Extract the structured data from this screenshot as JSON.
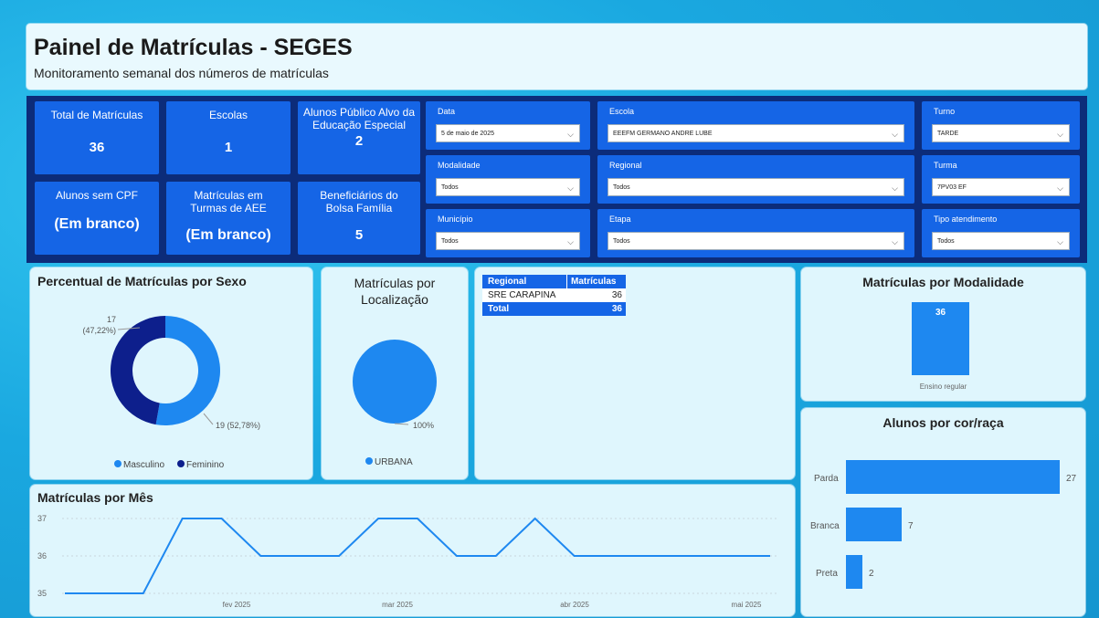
{
  "header": {
    "title": "Painel de Matrículas - SEGES",
    "subtitle": "Monitoramento semanal dos números de matrículas"
  },
  "kpis": {
    "total_matriculas": {
      "label": "Total de Matrículas",
      "value": "36"
    },
    "escolas": {
      "label": "Escolas",
      "value": "1"
    },
    "aee": {
      "label": "Alunos Público Alvo da Educação Especial",
      "value": "2"
    },
    "sem_cpf": {
      "label": "Alunos sem CPF",
      "value": "(Em branco)"
    },
    "turmas_aee": {
      "label": "Matrículas em Turmas de AEE",
      "value": "(Em branco)"
    },
    "bolsa": {
      "label": "Beneficiários do Bolsa Família",
      "value": "5"
    }
  },
  "filters": {
    "data": {
      "label": "Data",
      "value": "5 de maio de 2025"
    },
    "escola": {
      "label": "Escola",
      "value": "EEEFM GERMANO ANDRE LUBE"
    },
    "turno": {
      "label": "Turno",
      "value": "TARDE"
    },
    "modalidade": {
      "label": "Modalidade",
      "value": "Todos"
    },
    "regional": {
      "label": "Regional",
      "value": "Todos"
    },
    "turma": {
      "label": "Turma",
      "value": "7PV03 EF"
    },
    "municipio": {
      "label": "Município",
      "value": "Todos"
    },
    "etapa": {
      "label": "Etapa",
      "value": "Todos"
    },
    "tipo_atendimento": {
      "label": "Tipo atendimento",
      "value": "Todos"
    }
  },
  "sexo_chart": {
    "title": "Percentual de Matrículas por Sexo",
    "label_feminino_n": "17",
    "label_feminino_p": "(47,22%)",
    "label_masculino": "19 (52,78%)",
    "legend_masculino": "Masculino",
    "legend_feminino": "Feminino",
    "color_masculino": "#1e88f0",
    "color_feminino": "#0d1f8c"
  },
  "localizacao_chart": {
    "title_line1": "Matrículas por",
    "title_line2": "Localização",
    "label": "100%",
    "legend": "URBANA",
    "color": "#1e88f0"
  },
  "regional_table": {
    "headers": [
      "Regional",
      "Matrículas"
    ],
    "rows": [
      [
        "SRE CARAPINA",
        "36"
      ]
    ],
    "total": [
      "Total",
      "36"
    ]
  },
  "modalidade_chart": {
    "title": "Matrículas por Modalidade",
    "category": "Ensino regular",
    "value": "36"
  },
  "cor_chart": {
    "title": "Alunos por cor/raça",
    "bars": [
      {
        "label": "Parda",
        "value": "27"
      },
      {
        "label": "Branca",
        "value": "7"
      },
      {
        "label": "Preta",
        "value": "2"
      }
    ]
  },
  "chart_data": [
    {
      "type": "pie",
      "title": "Percentual de Matrículas por Sexo",
      "categories": [
        "Masculino",
        "Feminino"
      ],
      "values": [
        19,
        17
      ]
    },
    {
      "type": "pie",
      "title": "Matrículas por Localização",
      "categories": [
        "URBANA"
      ],
      "values": [
        100
      ]
    },
    {
      "type": "bar",
      "title": "Matrículas por Modalidade",
      "categories": [
        "Ensino regular"
      ],
      "values": [
        36
      ]
    },
    {
      "type": "bar",
      "title": "Alunos por cor/raça",
      "categories": [
        "Parda",
        "Branca",
        "Preta"
      ],
      "values": [
        27,
        7,
        2
      ]
    },
    {
      "type": "line",
      "title": "Matrículas por Mês",
      "yticks": [
        "37",
        "36",
        "35"
      ],
      "xticks": [
        "fev 2025",
        "mar 2025",
        "abr 2025",
        "mai 2025"
      ],
      "ylim": [
        35,
        37
      ],
      "series": [
        {
          "values": [
            35,
            35,
            35,
            37,
            37,
            36,
            36,
            36,
            37,
            37,
            36,
            36,
            37,
            36,
            36,
            36,
            36,
            36,
            36
          ]
        }
      ]
    }
  ],
  "mes_chart": {
    "title": "Matrículas por Mês",
    "yticks": [
      "37",
      "36",
      "35"
    ],
    "xticks": [
      "fev 2025",
      "mar 2025",
      "abr 2025",
      "mai 2025"
    ],
    "color": "#1e88f0"
  }
}
